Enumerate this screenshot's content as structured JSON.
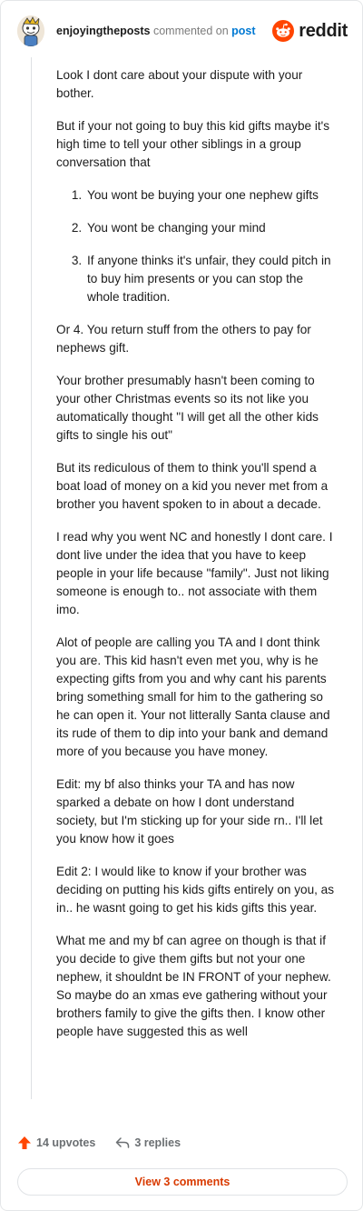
{
  "header": {
    "username": "enjoyingtheposts",
    "action": "commented on",
    "post_link": "post",
    "logo_text": "reddit",
    "avatar_icon": "snoo-avatar-icon",
    "logo_icon": "reddit-snoo-icon",
    "brand_color": "#ff4500"
  },
  "comment": {
    "p1": "Look I dont care about your dispute with your bother.",
    "p2": "But if your not going to buy this kid gifts maybe it's high time to tell your other siblings in a group conversation that",
    "list": [
      "You wont be buying your one nephew gifts",
      "You wont be changing your mind",
      "If anyone thinks it's unfair, they could pitch in to buy him presents or you can stop the whole tradition."
    ],
    "p3": "Or 4. You return stuff from the others to pay for nephews gift.",
    "p4": "Your brother presumably hasn't been coming to your other Christmas events so its not like you automatically thought \"I will get all the other kids gifts to single his out\"",
    "p5": "But its rediculous of them to think you'll spend a boat load of money on a kid you never met from a brother you havent spoken to in about a decade.",
    "p6": "I read why you went NC and honestly I dont care. I dont live under the idea that you have to keep people in your life because \"family\". Just not liking someone is enough to.. not associate with them imo.",
    "p7": "Alot of people are calling you TA and I dont think you are. This kid hasn't even met you, why is he expecting gifts from you and why cant his parents bring something small for him to the gathering so he can open it. Your not litterally Santa clause and its rude of them to dip into your bank and demand more of you because you have money.",
    "p8": "Edit: my bf also thinks your TA and has now sparked a debate on how I dont understand society, but I'm sticking up for your side rn.. I'll let you know how it goes",
    "p9": "Edit 2: I would like to know if your brother was deciding on putting his kids gifts entirely on you, as in.. he wasnt going to get his kids gifts this year.",
    "p10": "What me and my bf can agree on though is that if you decide to give them gifts but not your one nephew, it shouldnt be IN FRONT of your nephew. So maybe do an xmas eve gathering without your brothers family to give the gifts then. I know other people have suggested this as well"
  },
  "footer": {
    "upvotes": "14 upvotes",
    "replies": "3 replies",
    "view_comments": "View 3 comments",
    "upvote_icon": "upvote-arrow-icon",
    "reply_icon": "reply-arrow-icon"
  }
}
